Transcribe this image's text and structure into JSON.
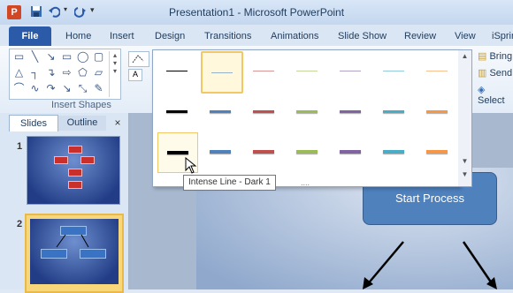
{
  "window": {
    "title": "Presentation1 - Microsoft PowerPoint",
    "app_icon_letter": "P"
  },
  "ribbon_tabs": [
    "File",
    "Home",
    "Insert",
    "Design",
    "Transitions",
    "Animations",
    "Slide Show",
    "Review",
    "View",
    "iSpring"
  ],
  "ribbon": {
    "insert_shapes_label": "Insert Shapes",
    "arrange": {
      "bring_forward": "Bring",
      "send_backward": "Send",
      "selection": "Select"
    }
  },
  "gallery": {
    "tooltip": "Intense Line - Dark 1",
    "grip": "....",
    "colors": [
      "#000000",
      "#4f81bd",
      "#c0504d",
      "#9bbb59",
      "#8064a2",
      "#4bacc6",
      "#f79646"
    ],
    "rows": [
      {
        "style": "thin",
        "colors": [
          "#000000",
          "#4f81bd",
          "#c0504d",
          "#9bbb59",
          "#8064a2",
          "#4bacc6",
          "#f79646"
        ]
      },
      {
        "style": "moderate",
        "colors": [
          "#000000",
          "#4f81bd",
          "#c0504d",
          "#9bbb59",
          "#8064a2",
          "#4bacc6",
          "#f79646"
        ]
      },
      {
        "style": "intense",
        "colors": [
          "#000000",
          "#4f81bd",
          "#c0504d",
          "#9bbb59",
          "#8064a2",
          "#4bacc6",
          "#f79646"
        ]
      }
    ]
  },
  "left_pane": {
    "tab_slides": "Slides",
    "tab_outline": "Outline",
    "close": "×",
    "slide_numbers": [
      "1",
      "2"
    ]
  },
  "slide": {
    "start_process": "Start Process"
  }
}
